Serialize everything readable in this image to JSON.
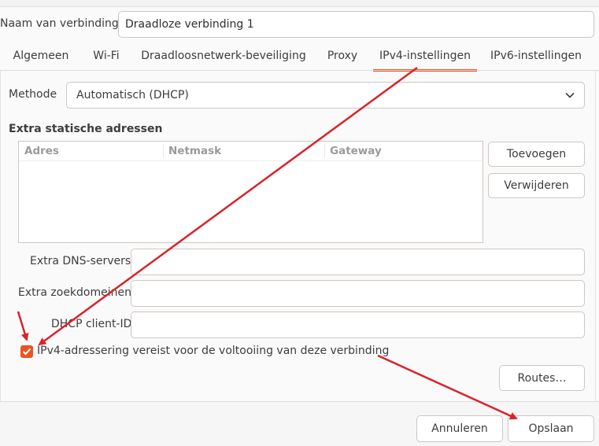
{
  "connection": {
    "name_label": "Naam van verbinding",
    "name_value": "Draadloze verbinding 1"
  },
  "tabs": [
    {
      "label": "Algemeen"
    },
    {
      "label": "Wi-Fi"
    },
    {
      "label": "Draadloosnetwerk-beveiliging"
    },
    {
      "label": "Proxy"
    },
    {
      "label": "IPv4-instellingen",
      "active": true
    },
    {
      "label": "IPv6-instellingen"
    }
  ],
  "ipv4": {
    "method_label": "Methode",
    "method_value": "Automatisch (DHCP)",
    "static_title": "Extra statische adressen",
    "columns": [
      "Adres",
      "Netmask",
      "Gateway"
    ],
    "rows": [],
    "add_button": "Toevoegen",
    "remove_button": "Verwijderen",
    "dns_label": "Extra DNS-servers",
    "dns_value": "",
    "search_label": "Extra zoekdomeinen",
    "search_value": "",
    "dhcp_label": "DHCP client-ID",
    "dhcp_value": "",
    "require_ipv4_label": "IPv4-adressering vereist voor de voltooiing van deze verbinding",
    "require_ipv4_checked": true,
    "routes_button": "Routes…"
  },
  "footer": {
    "cancel_button": "Annuleren",
    "save_button": "Opslaan"
  },
  "colors": {
    "accent": "#e95420",
    "annotation_arrow": "#d9232b"
  }
}
